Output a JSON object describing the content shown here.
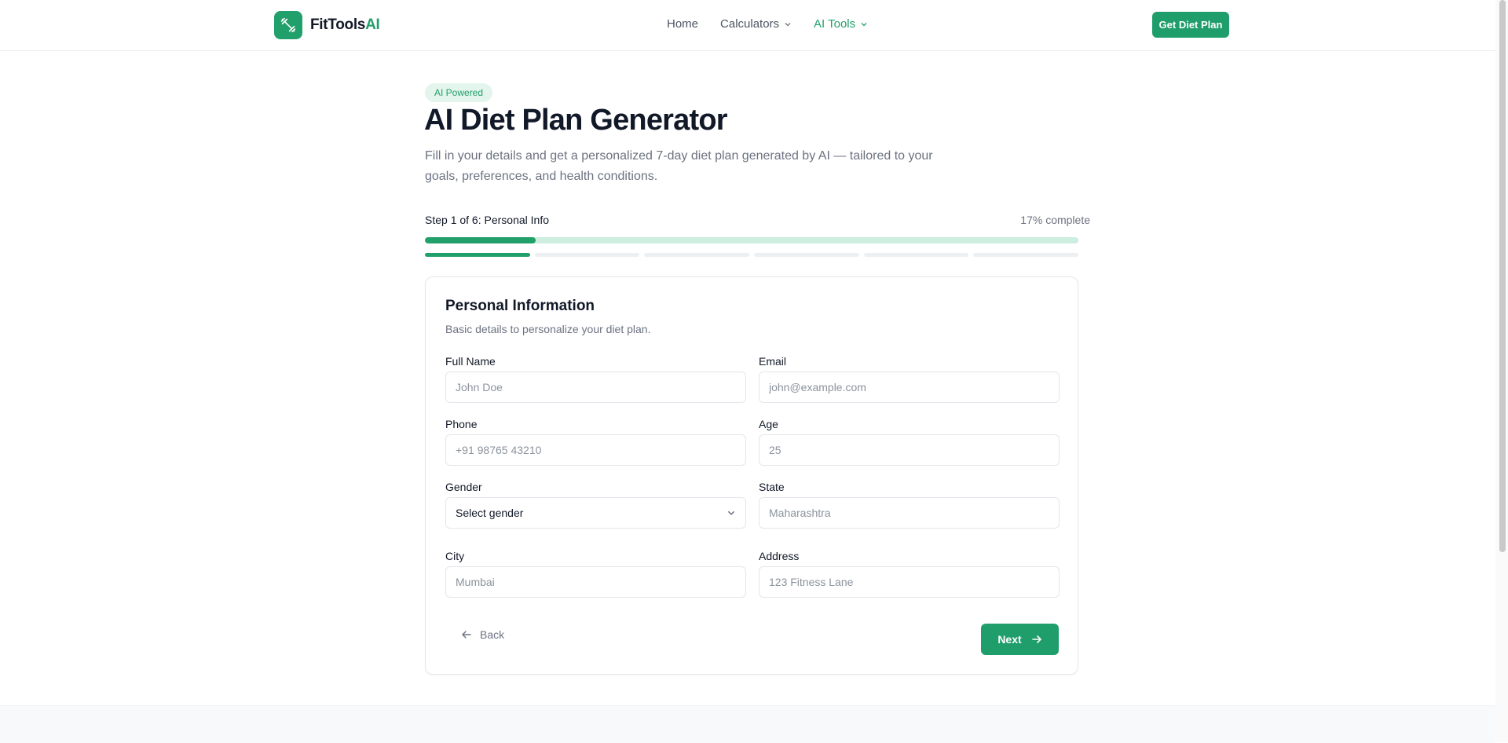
{
  "brand": {
    "name": "FitTools",
    "accent": "AI",
    "color": "#22a06b",
    "icon": "weights-icon"
  },
  "nav": {
    "items": [
      {
        "label": "Home",
        "has_dropdown": false,
        "active": false
      },
      {
        "label": "Calculators",
        "has_dropdown": true,
        "active": false
      },
      {
        "label": "AI Tools",
        "has_dropdown": true,
        "active": true
      }
    ],
    "cta_label": "Get Diet Plan"
  },
  "hero": {
    "badge": "AI Powered",
    "title": "AI Diet Plan Generator",
    "subtitle": "Fill in your details and get a personalized 7-day diet plan generated by AI — tailored to your goals, preferences, and health conditions."
  },
  "progress": {
    "step_label": "Step 1 of 6: Personal Info",
    "percent_label": "17% complete",
    "percent": 17,
    "current_step": 1,
    "total_steps": 6
  },
  "form": {
    "title": "Personal Information",
    "description": "Basic details to personalize your diet plan.",
    "fields": {
      "full_name": {
        "label": "Full Name",
        "placeholder": "John Doe"
      },
      "email": {
        "label": "Email",
        "placeholder": "john@example.com"
      },
      "phone": {
        "label": "Phone",
        "placeholder": "+91 98765 43210"
      },
      "age": {
        "label": "Age",
        "placeholder": "25"
      },
      "gender": {
        "label": "Gender",
        "value": "Select gender"
      },
      "state": {
        "label": "State",
        "placeholder": "Maharashtra"
      },
      "city": {
        "label": "City",
        "placeholder": "Mumbai"
      },
      "address": {
        "label": "Address",
        "placeholder": "123 Fitness Lane"
      }
    },
    "back_label": "Back",
    "next_label": "Next"
  }
}
